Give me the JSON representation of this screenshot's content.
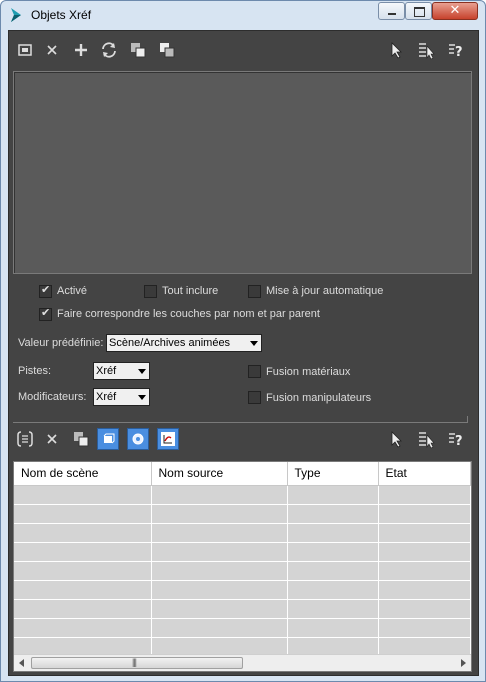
{
  "window": {
    "title": "Objets Xréf"
  },
  "options": {
    "active": {
      "label": "Activé",
      "checked": true
    },
    "include_all": {
      "label": "Tout inclure",
      "checked": false
    },
    "auto_update": {
      "label": "Mise à jour automatique",
      "checked": false
    },
    "match_layers": {
      "label": "Faire correspondre les couches par nom et par parent",
      "checked": true
    }
  },
  "preset": {
    "label": "Valeur prédéfinie:",
    "value": "Scène/Archives animées"
  },
  "tracks": {
    "label": "Pistes:",
    "value": "Xréf"
  },
  "modifiers": {
    "label": "Modificateurs:",
    "value": "Xréf"
  },
  "merge_materials": {
    "label": "Fusion matériaux",
    "checked": false
  },
  "merge_manipulators": {
    "label": "Fusion manipulateurs",
    "checked": false
  },
  "table": {
    "columns": [
      "Nom de scène",
      "Nom source",
      "Type",
      "Etat"
    ],
    "row_count": 9
  },
  "scrollbar": {
    "grip": "|||"
  },
  "colors": {
    "panel": "#444444",
    "accent": "#4a8ee0"
  }
}
